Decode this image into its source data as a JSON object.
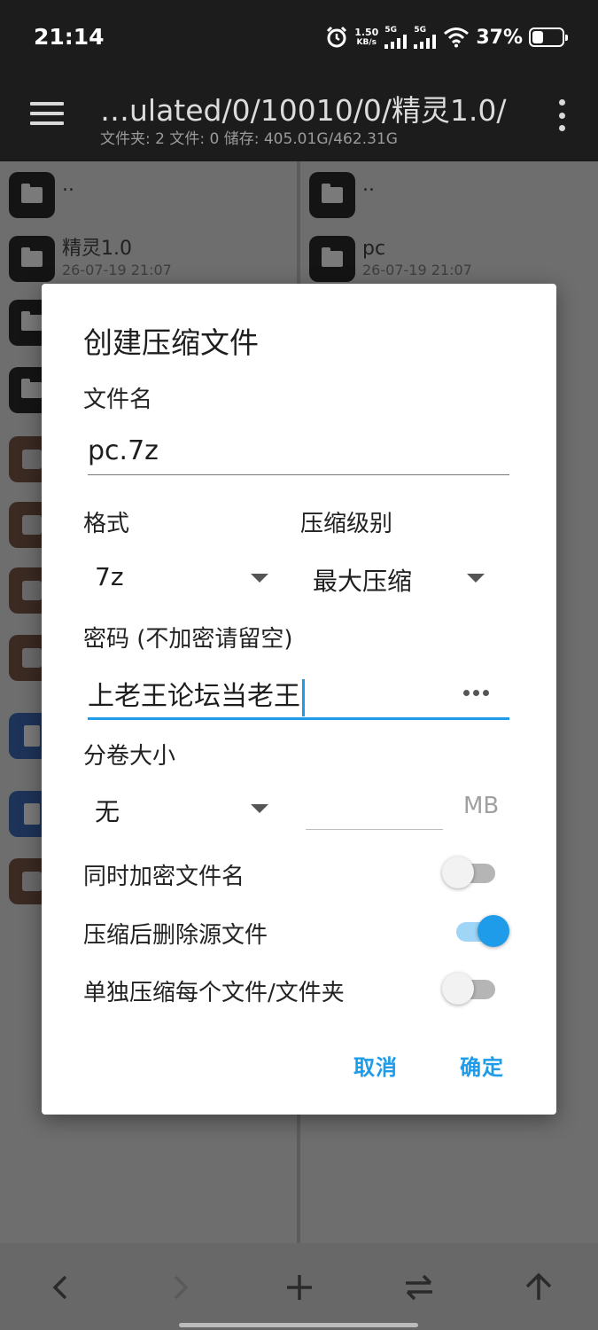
{
  "status_bar": {
    "time": "21:14",
    "net_speed_value": "1.50",
    "net_speed_unit": "KB/s",
    "sim1": "5G",
    "sim2": "5G",
    "battery": "37%",
    "battery_level": 0.37
  },
  "toolbar": {
    "path": "…ulated/0/10010/0/精灵1.0/",
    "info": "文件夹: 2  文件: 0  储存: 405.01G/462.31G"
  },
  "left_pane": {
    "parent": "..",
    "item1_name": "精灵1.0",
    "item1_date": "26-07-19 21:07"
  },
  "right_pane": {
    "parent": "..",
    "item1_name": "pc",
    "item1_date": "26-07-19 21:07"
  },
  "dialog": {
    "title": "创建压缩文件",
    "filename_label": "文件名",
    "filename_value": "pc.7z",
    "format_label": "格式",
    "format_value": "7z",
    "level_label": "压缩级别",
    "level_value": "最大压缩",
    "password_label": "密码 (不加密请留空)",
    "password_value": "上老王论坛当老王",
    "volume_label": "分卷大小",
    "volume_value": "无",
    "volume_unit": "MB",
    "encrypt_names_label": "同时加密文件名",
    "encrypt_names_on": false,
    "delete_source_label": "压缩后删除源文件",
    "delete_source_on": true,
    "separate_label": "单独压缩每个文件/文件夹",
    "separate_on": false,
    "cancel": "取消",
    "ok": "确定"
  },
  "bottom_nav": {
    "back_icon": "chevron-left-icon",
    "forward_icon": "chevron-right-icon",
    "add_icon": "plus-icon",
    "swap_icon": "swap-icon",
    "up_icon": "arrow-up-icon"
  },
  "colors": {
    "accent": "#1e9be9"
  }
}
